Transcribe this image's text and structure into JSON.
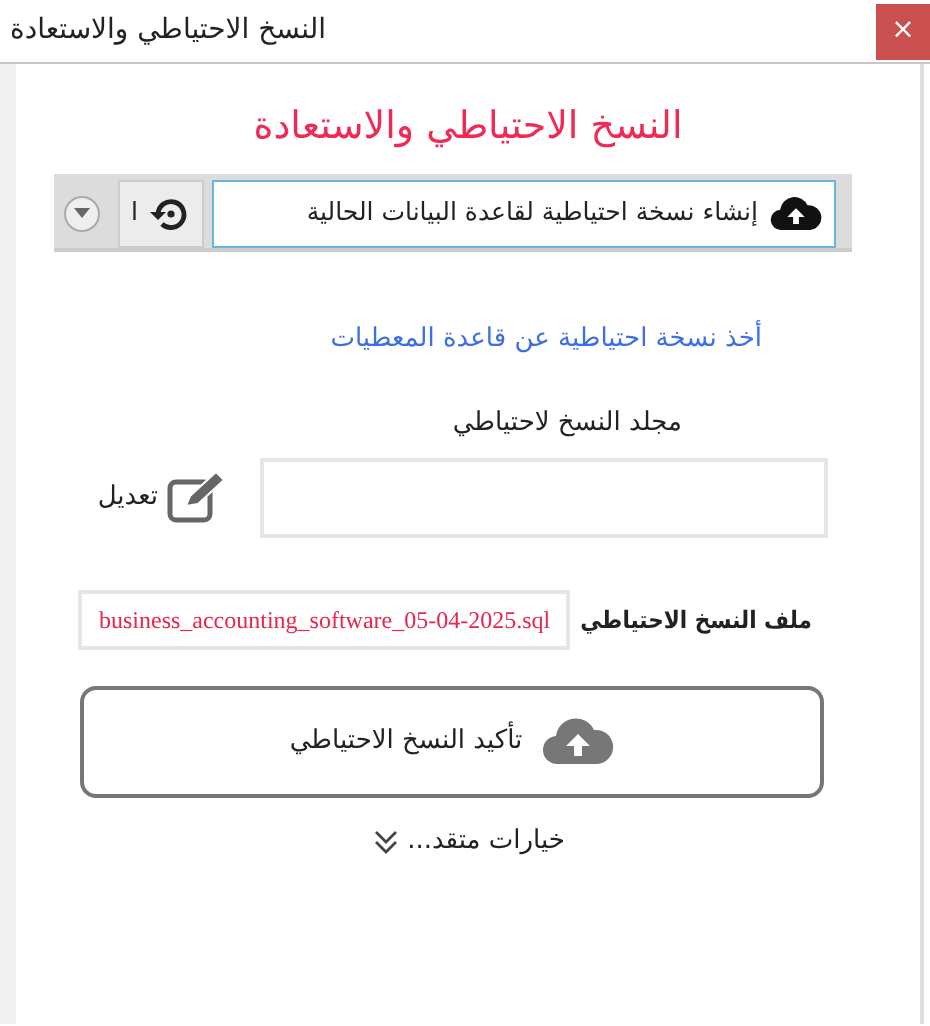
{
  "window": {
    "title": "النسخ الاحتياطي والاستعادة",
    "close_button": "×"
  },
  "heading": "النسخ الاحتياطي والاستعادة",
  "tabs": [
    {
      "label": "إنشاء نسخة احتياطية لقاعدة البيانات الحالية",
      "selected": true
    },
    {
      "label": "ا",
      "selected": false
    }
  ],
  "section_link": "أخذ نسخة احتياطية عن قاعدة المعطيات",
  "folder": {
    "label": "مجلد النسخ لاحتياطي",
    "edit_button": "تعديل"
  },
  "file": {
    "label": "ملف النسخ الاحتياطي",
    "value": "business_accounting_software_05-04-2025.sql"
  },
  "confirm_button": "تأكيد النسخ الاحتياطي",
  "advanced_toggle": {
    "label": "خيارات متقد...",
    "expanded": false
  }
}
